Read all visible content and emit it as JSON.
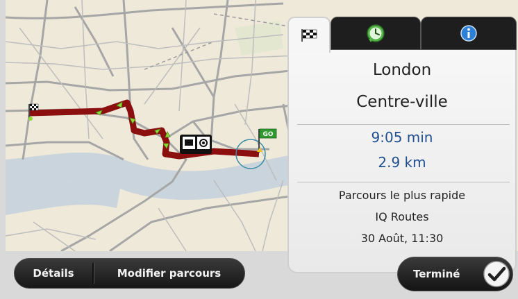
{
  "panel": {
    "tabs": [
      {
        "name": "route-summary",
        "icon": "checkered-flag-icon",
        "active": true
      },
      {
        "name": "traffic",
        "icon": "clock-traffic-icon",
        "active": false
      },
      {
        "name": "info",
        "icon": "info-icon",
        "active": false
      }
    ],
    "destination": "London",
    "area": "Centre-ville",
    "travel_time": "9:05 min",
    "distance": "2.9 km",
    "route_type": "Parcours le plus rapide",
    "route_source": "IQ Routes",
    "departure": "30 Août, 11:30"
  },
  "bottom": {
    "details_label": "Détails",
    "modify_label": "Modifier parcours",
    "done_label": "Terminé"
  },
  "map": {
    "start_flag_label": "GO",
    "route_color": "#8b0f0f",
    "arrow_color": "#8edc3a",
    "river_color": "#c9d4dc",
    "land_color": "#efe9da"
  }
}
